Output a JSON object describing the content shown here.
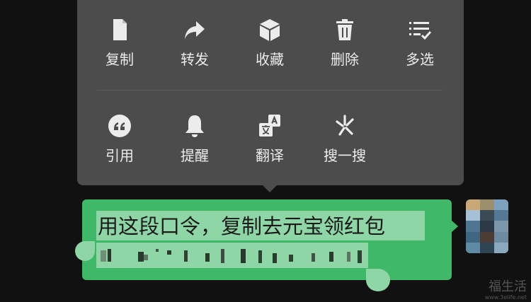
{
  "menu": {
    "row1": [
      {
        "label": "复制",
        "icon": "document-icon"
      },
      {
        "label": "转发",
        "icon": "forward-arrow-icon"
      },
      {
        "label": "收藏",
        "icon": "cube-icon"
      },
      {
        "label": "删除",
        "icon": "trash-icon"
      },
      {
        "label": "多选",
        "icon": "checklist-icon"
      }
    ],
    "row2": [
      {
        "label": "引用",
        "icon": "quote-icon"
      },
      {
        "label": "提醒",
        "icon": "bell-icon"
      },
      {
        "label": "翻译",
        "icon": "translate-icon"
      },
      {
        "label": "搜一搜",
        "icon": "search-spark-icon"
      }
    ]
  },
  "message": {
    "line1": "用这段口令，复制去元宝领红包",
    "line2_note": "pixelated code"
  },
  "watermark": {
    "main": "福生活",
    "sub": "www.3elife.net"
  },
  "colors": {
    "menu_bg": "#4c4c4c",
    "bubble": "#3fb867",
    "selection": "#8fd6a7",
    "background": "#111111"
  }
}
